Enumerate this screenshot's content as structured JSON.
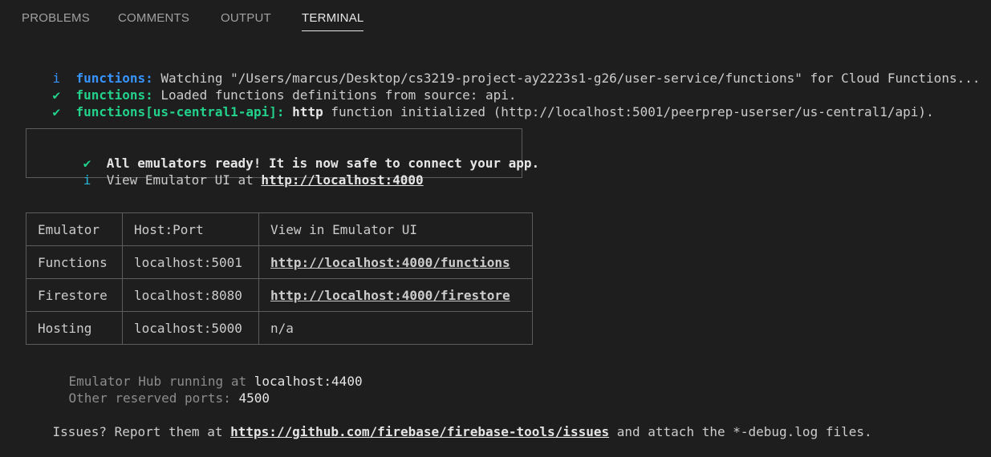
{
  "tabs": [
    {
      "label": "PROBLEMS",
      "active": false
    },
    {
      "label": "COMMENTS",
      "active": false
    },
    {
      "label": "OUTPUT",
      "active": false
    },
    {
      "label": "TERMINAL",
      "active": true
    }
  ],
  "log": {
    "line1": {
      "glyph": "i",
      "tag": "functions:",
      "text": " Watching \"/Users/marcus/Desktop/cs3219-project-ay2223s1-g26/user-service/functions\" for Cloud Functions..."
    },
    "line2": {
      "glyph": "✔",
      "tag": "functions:",
      "text": " Loaded functions definitions from source: api."
    },
    "line3": {
      "glyph": "✔",
      "tag": "functions[us-central1-api]:",
      "bold": "http",
      "text": " function initialized (http://localhost:5001/peerprep-userser/us-central1/api)."
    }
  },
  "ready_box": {
    "glyph1": "✔",
    "line1": "All emulators ready! It is now safe to connect your app.",
    "glyph2": "i",
    "line2_prefix": "View Emulator UI at ",
    "line2_link": "http://localhost:4000"
  },
  "table": {
    "headers": [
      "Emulator",
      "Host:Port",
      "View in Emulator UI"
    ],
    "rows": [
      {
        "emulator": "Functions",
        "host": "localhost:5001",
        "ui": "http://localhost:4000/functions"
      },
      {
        "emulator": "Firestore",
        "host": "localhost:8080",
        "ui": "http://localhost:4000/firestore"
      },
      {
        "emulator": "Hosting",
        "host": "localhost:5000",
        "ui": "n/a"
      }
    ]
  },
  "hub": {
    "prefix": "Emulator Hub running at ",
    "value": "localhost:4400"
  },
  "ports": {
    "prefix": "Other reserved ports: ",
    "value": "4500"
  },
  "issues": {
    "prefix": "Issues? Report them at ",
    "link": "https://github.com/firebase/firebase-tools/issues",
    "suffix": " and attach the *-debug.log files."
  },
  "colors": {
    "background": "#1e1e1e",
    "info": "#3794ff",
    "success": "#23d18b",
    "header": "#f5f543",
    "border": "#5c5c5c"
  }
}
